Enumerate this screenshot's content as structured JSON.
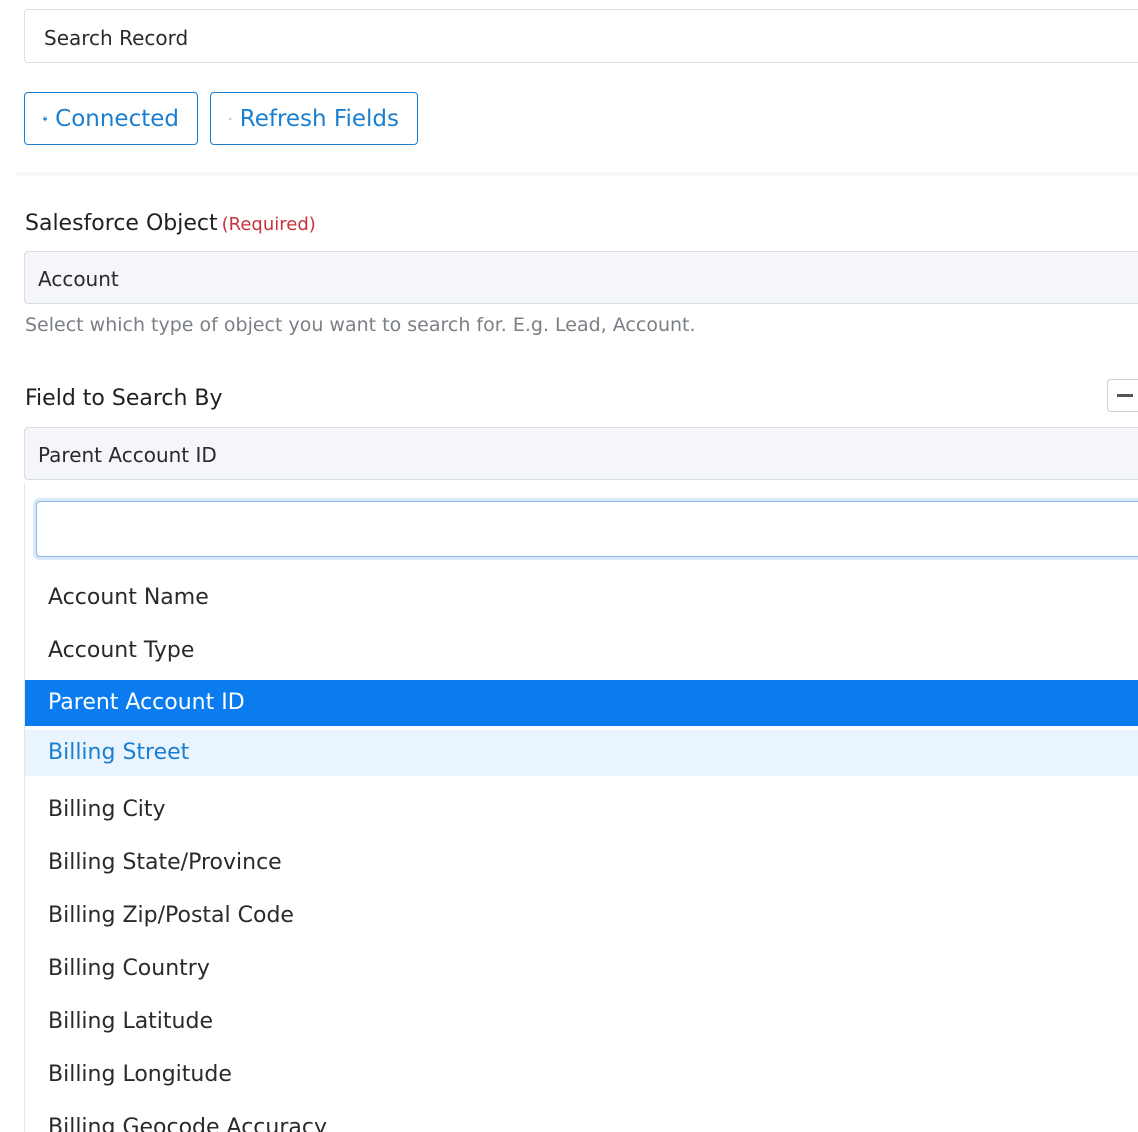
{
  "action": {
    "value": "Search Record"
  },
  "buttons": {
    "connected": "Connected",
    "refresh": "Refresh Fields"
  },
  "salesforce_object": {
    "label": "Salesforce Object",
    "required": "(Required)",
    "value": "Account",
    "help": "Select which type of object you want to search for. E.g. Lead, Account."
  },
  "field_to_search": {
    "label": "Field to Search By",
    "value": "Parent Account ID",
    "search_value": "",
    "options": [
      "Account Name",
      "Account Type",
      "Parent Account ID",
      "Billing Street",
      "Billing City",
      "Billing State/Province",
      "Billing Zip/Postal Code",
      "Billing Country",
      "Billing Latitude",
      "Billing Longitude",
      "Billing Geocode Accuracy"
    ]
  },
  "colors": {
    "accent": "#1a7fd0",
    "selected": "#0a7cf0",
    "hover": "#eaf4fe",
    "required": "#c8323c"
  }
}
